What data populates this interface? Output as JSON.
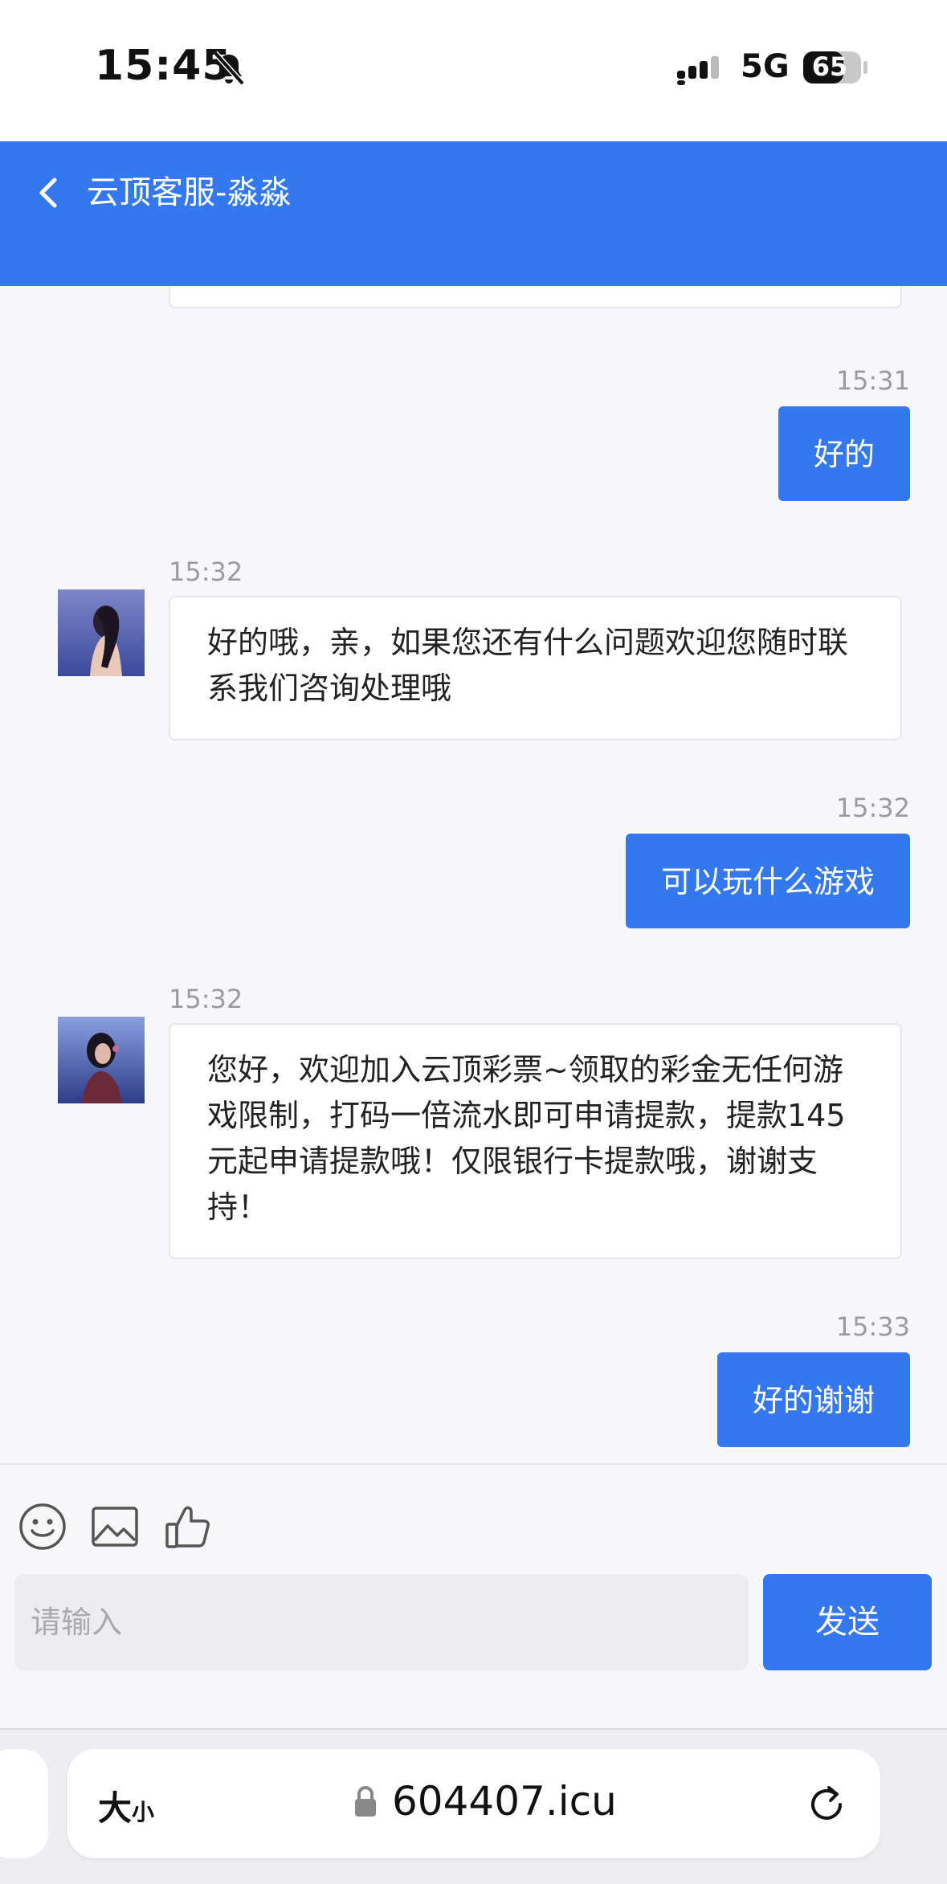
{
  "status_bar": {
    "time": "15:45",
    "network": "5G",
    "battery": "65"
  },
  "header": {
    "title": "云顶客服-淼淼",
    "back_icon": "chevron-left-icon"
  },
  "messages": [
    {
      "direction": "out",
      "time": "15:31",
      "text": "好的"
    },
    {
      "direction": "in",
      "time": "15:32",
      "lines": [
        "好的哦，亲，如果您还有什么问题欢迎您随时联",
        "系我们咨询处理哦"
      ]
    },
    {
      "direction": "out",
      "time": "15:32",
      "text": "可以玩什么游戏"
    },
    {
      "direction": "in",
      "time": "15:32",
      "lines": [
        "您好，欢迎加入云顶彩票~领取的彩金无任何游",
        "戏限制，打码一倍流水即可申请提款，提款145",
        "元起申请提款哦！仅限银行卡提款哦，谢谢支",
        "持！"
      ]
    },
    {
      "direction": "out",
      "time": "15:33",
      "text": "好的谢谢"
    }
  ],
  "composer": {
    "icons": [
      "smiley-icon",
      "image-icon",
      "thumbs-up-icon"
    ],
    "placeholder": "请输入",
    "send_label": "发送"
  },
  "browser": {
    "text_size_big": "大",
    "text_size_small": "小",
    "url": "604407.icu"
  },
  "colors": {
    "accent": "#3478f0",
    "background": "#f7f7f9"
  }
}
